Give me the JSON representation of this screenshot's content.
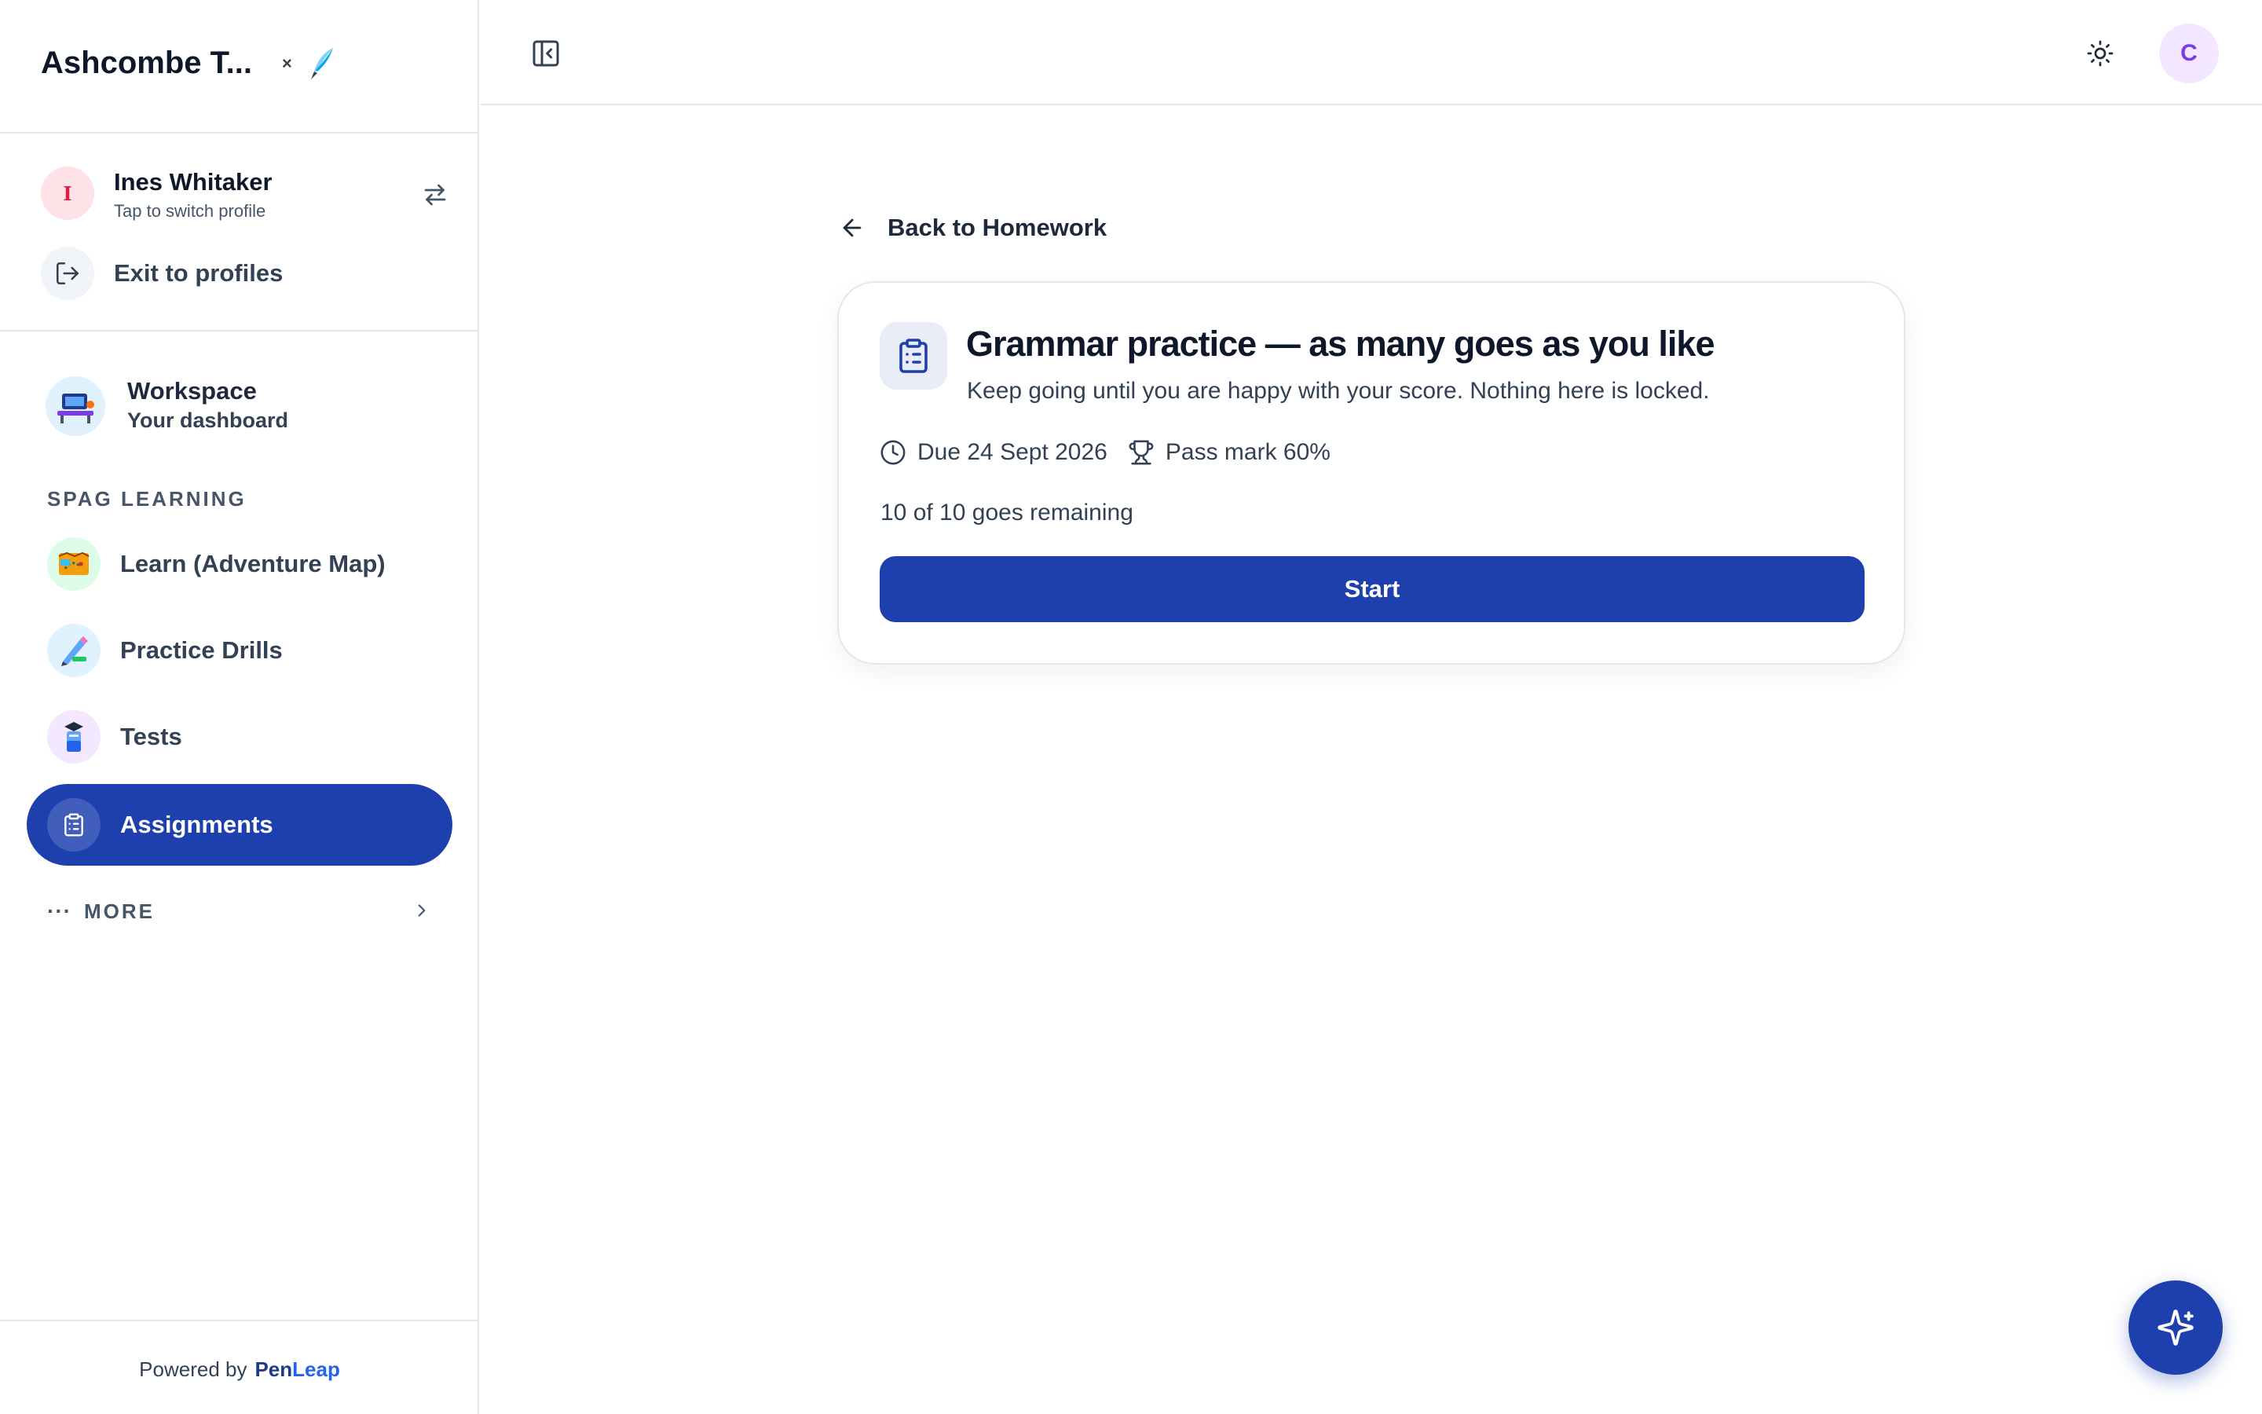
{
  "sidebar": {
    "brand": {
      "name": "Ashcombe T...",
      "close_glyph": "×",
      "logo_icon": "quill-icon"
    },
    "profile": {
      "initial": "I",
      "name": "Ines Whitaker",
      "subtitle": "Tap to switch profile",
      "switch_icon": "swap-arrows-icon"
    },
    "exit": {
      "label": "Exit to profiles",
      "icon": "exit-icon"
    },
    "workspace": {
      "title": "Workspace",
      "subtitle": "Your dashboard",
      "icon": "workspace-desk-icon"
    },
    "section_label": "SPAG LEARNING",
    "nav_items": [
      {
        "label": "Learn (Adventure Map)",
        "icon": "treasure-map-icon",
        "active": false
      },
      {
        "label": "Practice Drills",
        "icon": "pencil-drill-icon",
        "active": false
      },
      {
        "label": "Tests",
        "icon": "test-tube-graduate-icon",
        "active": false
      },
      {
        "label": "Assignments",
        "icon": "clipboard-icon",
        "active": true
      }
    ],
    "more": {
      "dots": "···",
      "label": "MORE"
    },
    "footer": {
      "prefix": "Powered by",
      "brand_a": "Pen",
      "brand_b": "Leap"
    }
  },
  "header": {
    "collapse_icon": "panel-collapse-icon",
    "theme_icon": "sun-icon",
    "user_initial": "C"
  },
  "main": {
    "back_label": "Back to Homework",
    "assignment": {
      "title": "Grammar practice — as many goes as you like",
      "description": "Keep going until you are happy with your score. Nothing here is locked.",
      "due": "Due 24 Sept 2026",
      "pass_mark": "Pass mark 60%",
      "goes_remaining": "10 of 10 goes remaining",
      "start_label": "Start"
    },
    "fab_icon": "sparkles-icon"
  },
  "colors": {
    "accent": "#1e40af",
    "border": "#e5e7eb",
    "text_primary": "#0f172a",
    "text_secondary": "#334155",
    "profile_avatar_bg": "#fde2e7",
    "user_avatar_bg": "#f3e8ff"
  }
}
